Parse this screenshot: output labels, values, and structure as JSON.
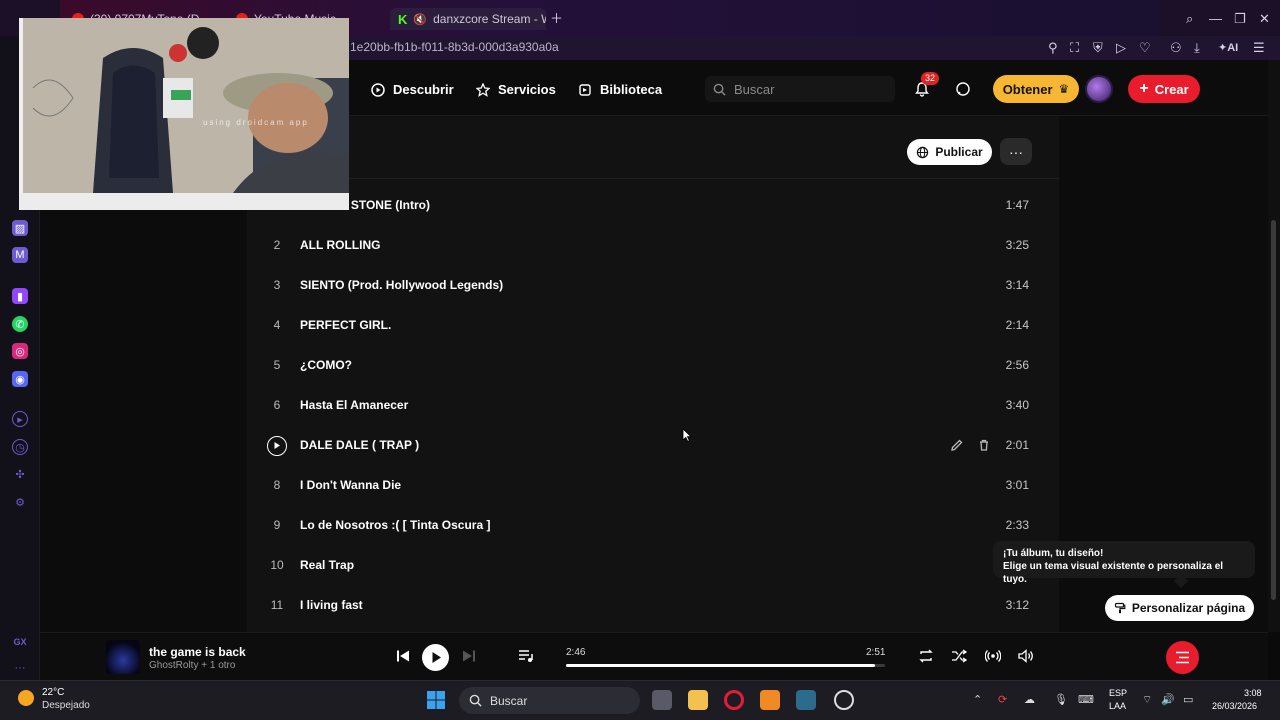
{
  "browser": {
    "tabs": [
      {
        "label": "(30) 0707MyTone (D..."
      },
      {
        "label": "YouTube Music"
      },
      {
        "label": "danxzcore Stream - W"
      }
    ],
    "url": "1e20bb-fb1b-f011-8b3d-000d3a930a0a",
    "ai_label": "AI"
  },
  "webcam": {
    "overlay_text": "using droidcam app"
  },
  "header": {
    "nav": [
      {
        "label": "Descubrir"
      },
      {
        "label": "Servicios"
      },
      {
        "label": "Biblioteca"
      }
    ],
    "search_placeholder": "Buscar",
    "notification_count": "32",
    "obtener_label": "Obtener",
    "crear_label": "Crear"
  },
  "toolbar": {
    "publicar_label": "Publicar",
    "more_label": "···"
  },
  "tracks": [
    {
      "num": "",
      "title": "ROLLIN' STONE (Intro)",
      "duration": "1:47"
    },
    {
      "num": "2",
      "title": "ALL ROLLING",
      "duration": "3:25"
    },
    {
      "num": "3",
      "title": "SIENTO (Prod. Hollywood Legends)",
      "duration": "3:14"
    },
    {
      "num": "4",
      "title": "PERFECT GIRL.",
      "duration": "2:14"
    },
    {
      "num": "5",
      "title": "¿COMO?",
      "duration": "2:56"
    },
    {
      "num": "6",
      "title": "Hasta El Amanecer",
      "duration": "3:40"
    },
    {
      "num": "",
      "title": "DALE DALE ( TRAP )",
      "duration": "2:01"
    },
    {
      "num": "8",
      "title": "I Don't Wanna Die",
      "duration": "3:01"
    },
    {
      "num": "9",
      "title": "Lo de Nosotros :( [ Tinta Oscura ]",
      "duration": "2:33"
    },
    {
      "num": "10",
      "title": "Real Trap",
      "duration": ""
    },
    {
      "num": "11",
      "title": "I living fast",
      "duration": "3:12"
    }
  ],
  "tooltip": {
    "line1": "¡Tu álbum, tu diseño!",
    "line2": "Elige un tema visual existente o personaliza el tuyo."
  },
  "personalizar_label": "Personalizar página",
  "player": {
    "title": "the game is back",
    "artist": "GhostRolty + 1 otro",
    "current_time": "2:46",
    "total_time": "2:51",
    "progress_fraction": 0.97
  },
  "taskbar": {
    "temp": "22°C",
    "weather": "Despejado",
    "search_label": "Buscar",
    "lang1": "ESP",
    "lang2": "LAA",
    "time": "3:08",
    "date": "26/03/2026"
  },
  "sidebar_labels": {
    "gx": "GX",
    "more": "···"
  }
}
